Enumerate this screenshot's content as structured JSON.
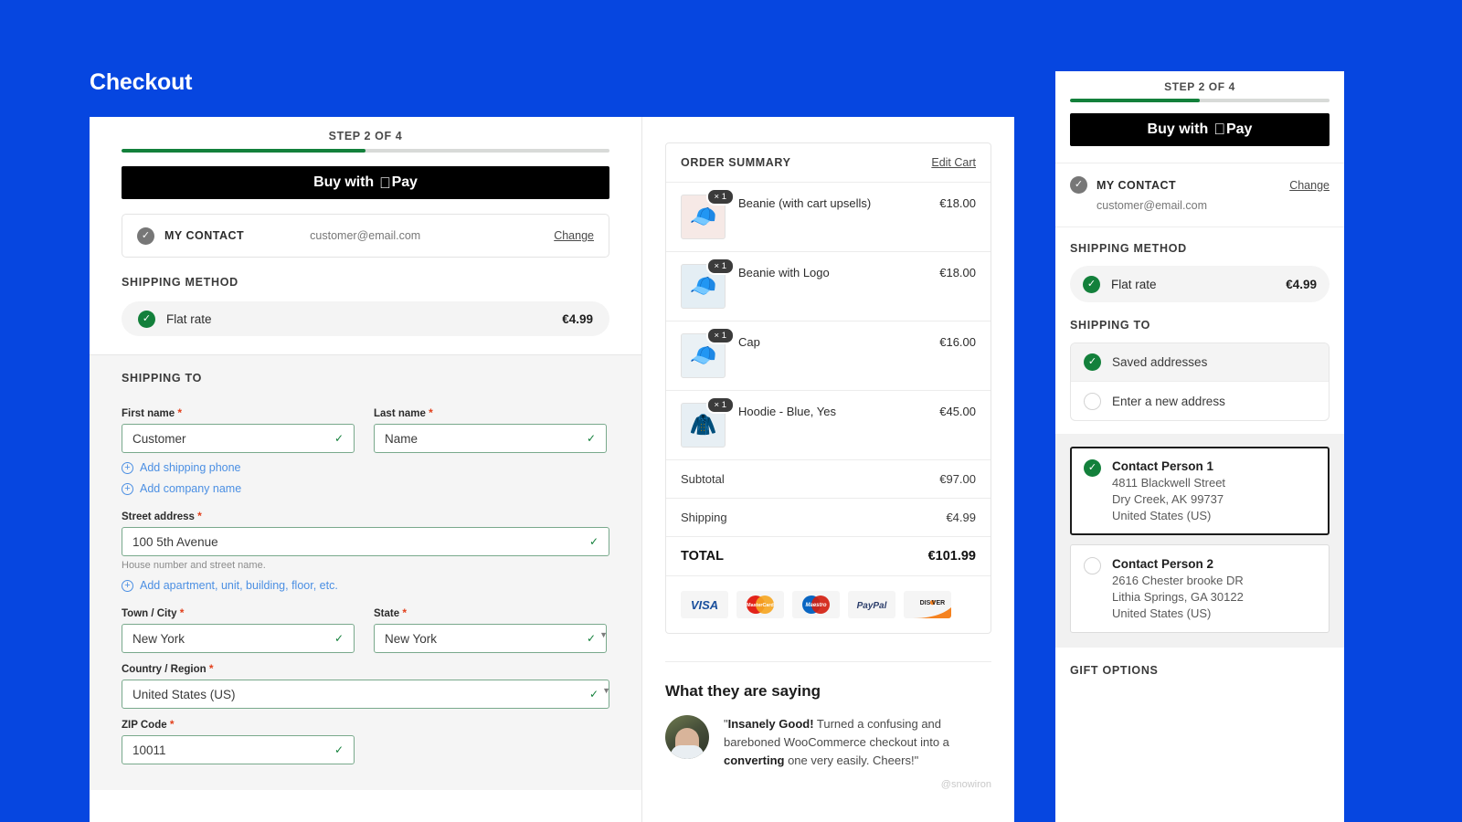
{
  "theme": {
    "background": "#0646e0",
    "accent_green": "#13803b",
    "link_blue": "#4b8fe3",
    "required_red": "#e2401c"
  },
  "page": {
    "title": "Checkout"
  },
  "progress": {
    "step_label": "STEP 2 OF 4",
    "percent": 50
  },
  "apple_pay": {
    "prefix": "Buy with",
    "glyph": "",
    "suffix": "Pay"
  },
  "contact": {
    "label": "MY CONTACT",
    "email": "customer@email.com",
    "change_label": "Change",
    "check_icon": "check-icon"
  },
  "shipping_method": {
    "heading": "SHIPPING METHOD",
    "options": [
      {
        "label": "Flat rate",
        "price": "€4.99",
        "selected": true
      }
    ]
  },
  "shipping_to": {
    "heading": "SHIPPING TO",
    "fields": {
      "first_name": {
        "label": "First name",
        "required": "*",
        "value": "Customer"
      },
      "last_name": {
        "label": "Last name",
        "required": "*",
        "value": "Name"
      },
      "street": {
        "label": "Street address",
        "required": "*",
        "value": "100 5th Avenue",
        "hint": "House number and street name."
      },
      "city": {
        "label": "Town / City",
        "required": "*",
        "value": "New York"
      },
      "state": {
        "label": "State",
        "required": "*",
        "value": "New York"
      },
      "country": {
        "label": "Country / Region",
        "required": "*",
        "value": "United States (US)"
      },
      "zip": {
        "label": "ZIP Code",
        "required": "*",
        "value": "10011"
      }
    },
    "add_links": [
      {
        "label": "Add shipping phone"
      },
      {
        "label": "Add company name"
      },
      {
        "label": "Add apartment, unit, building, floor, etc."
      }
    ]
  },
  "order_summary": {
    "title": "ORDER SUMMARY",
    "edit_label": "Edit Cart",
    "items": [
      {
        "name": "Beanie (with cart upsells)",
        "qty": "× 1",
        "price": "€18.00",
        "icon": "beanie-orange-icon",
        "glyph": "🧢",
        "tint": "#f6e9e6"
      },
      {
        "name": "Beanie with Logo",
        "qty": "× 1",
        "price": "€18.00",
        "icon": "beanie-blue-icon",
        "glyph": "🧢",
        "tint": "#e4eef4"
      },
      {
        "name": "Cap",
        "qty": "× 1",
        "price": "€16.00",
        "icon": "cap-yellow-icon",
        "glyph": "🧢",
        "tint": "#eaf1f5"
      },
      {
        "name": "Hoodie - Blue, Yes",
        "qty": "× 1",
        "price": "€45.00",
        "icon": "hoodie-blue-icon",
        "glyph": "🧥",
        "tint": "#e7eff4"
      }
    ],
    "totals": [
      {
        "label": "Subtotal",
        "value": "€97.00",
        "grand": false
      },
      {
        "label": "Shipping",
        "value": "€4.99",
        "grand": false
      },
      {
        "label": "TOTAL",
        "value": "€101.99",
        "grand": true
      }
    ],
    "payment_icons": [
      {
        "name": "visa-icon",
        "label": "VISA"
      },
      {
        "name": "mastercard-icon",
        "label": "MasterCard"
      },
      {
        "name": "maestro-icon",
        "label": "Maestro"
      },
      {
        "name": "paypal-icon",
        "label": "PayPal"
      },
      {
        "name": "discover-icon",
        "label": "DISC●VER"
      }
    ]
  },
  "testimonial": {
    "heading": "What they are saying",
    "quote_open": "\"",
    "bold_lead": "Insanely Good!",
    "text_mid": " Turned a confusing and bareboned WooCommerce checkout into a ",
    "bold_mid": "converting",
    "text_end": " one very easily. Cheers!\"",
    "handle": "@snowiron"
  },
  "mobile": {
    "progress": {
      "step_label": "STEP 2 OF 4",
      "percent": 50
    },
    "apple_pay": {
      "prefix": "Buy with",
      "glyph": "",
      "suffix": "Pay"
    },
    "contact": {
      "label": "MY CONTACT",
      "email": "customer@email.com",
      "change_label": "Change"
    },
    "shipping_method": {
      "heading": "SHIPPING METHOD",
      "option": {
        "label": "Flat rate",
        "price": "€4.99"
      }
    },
    "shipping_to": {
      "heading": "SHIPPING TO",
      "options": [
        {
          "label": "Saved addresses",
          "selected": true
        },
        {
          "label": "Enter a new address",
          "selected": false
        }
      ],
      "addresses": [
        {
          "name": "Contact Person 1",
          "line1": "4811 Blackwell Street",
          "line2": "Dry Creek, AK 99737",
          "line3": "United States (US)",
          "selected": true
        },
        {
          "name": "Contact Person 2",
          "line1": "2616 Chester brooke DR",
          "line2": "Lithia Springs, GA 30122",
          "line3": "United States (US)",
          "selected": false
        }
      ]
    },
    "gift_options": {
      "heading": "GIFT OPTIONS"
    }
  }
}
